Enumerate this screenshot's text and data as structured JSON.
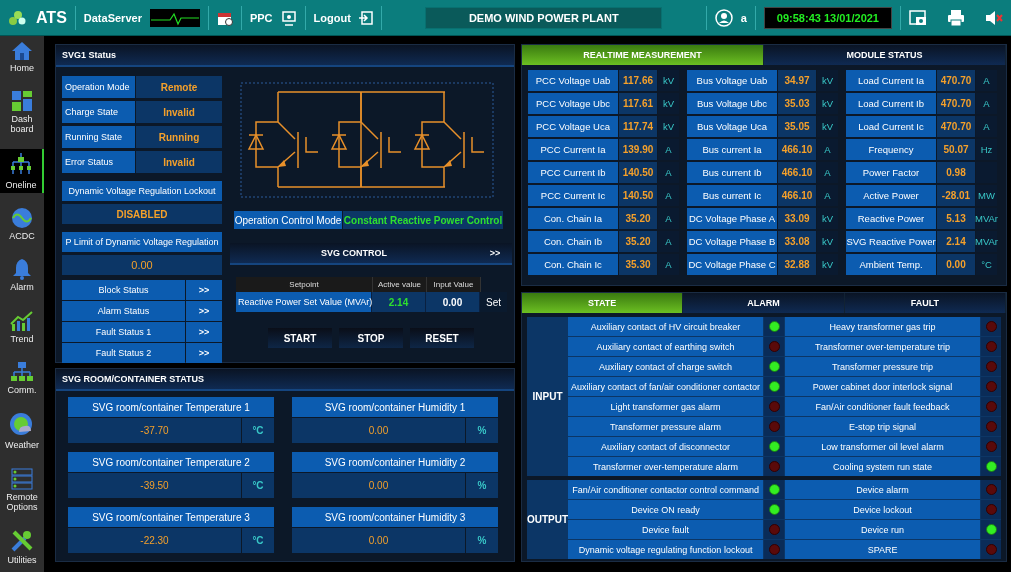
{
  "topbar": {
    "logo": "ATS",
    "server": "DataServer",
    "ppc": "PPC",
    "logout": "Logout",
    "plant": "DEMO WIND POWER PLANT",
    "user": "a",
    "clock": "09:58:43 13/01/2021"
  },
  "sidebar": {
    "items": [
      {
        "label": "Home",
        "selected": false
      },
      {
        "label": "Dash board",
        "selected": false
      },
      {
        "label": "Oneline",
        "selected": true
      },
      {
        "label": "ACDC",
        "selected": false
      },
      {
        "label": "Alarm",
        "selected": false
      },
      {
        "label": "Trend",
        "selected": false
      },
      {
        "label": "Comm.",
        "selected": false
      },
      {
        "label": "Weather",
        "selected": false
      },
      {
        "label": "Remote Options",
        "selected": false
      },
      {
        "label": "Utilities",
        "selected": false
      }
    ]
  },
  "svg1": {
    "title": "SVG1 Status",
    "status_rows": [
      {
        "label": "Operation Mode",
        "value": "Remote"
      },
      {
        "label": "Charge State",
        "value": "Invalid"
      },
      {
        "label": "Running State",
        "value": "Running"
      },
      {
        "label": "Error Status",
        "value": "Invalid"
      }
    ],
    "lockout": {
      "label": "Dynamic Voltage Regulation Lockout",
      "value": "DISABLED"
    },
    "p_limit": {
      "label": "P Limit of Dynamic Voltage Regulation",
      "value": "0.00"
    },
    "links": [
      {
        "label": "Block Status",
        "arrow": ">>"
      },
      {
        "label": "Alarm Status",
        "arrow": ">>"
      },
      {
        "label": "Fault Status 1",
        "arrow": ">>"
      },
      {
        "label": "Fault Status 2",
        "arrow": ">>"
      }
    ],
    "control_mode": {
      "label": "Operation Control Mode",
      "value": "Constant Reactive Power Control"
    },
    "svg_control": {
      "title": "SVG CONTROL",
      "arrow": ">>",
      "columns": [
        "Setpoint",
        "Active value",
        "Input Value"
      ],
      "row": {
        "label": "Reactive Power Set Value (MVAr)",
        "active": "2.14",
        "input": "0.00",
        "set": "Set"
      },
      "buttons": [
        "START",
        "STOP",
        "RESET"
      ]
    }
  },
  "room": {
    "title": "SVG ROOM/CONTAINER STATUS",
    "sensors": [
      {
        "label": "SVG room/container Temperature 1",
        "value": "-37.70",
        "unit": "°C"
      },
      {
        "label": "SVG room/container Humidity 1",
        "value": "0.00",
        "unit": "%"
      },
      {
        "label": "SVG room/container Temperature 2",
        "value": "-39.50",
        "unit": "°C"
      },
      {
        "label": "SVG room/container Humidity 2",
        "value": "0.00",
        "unit": "%"
      },
      {
        "label": "SVG room/container Temperature 3",
        "value": "-22.30",
        "unit": "°C"
      },
      {
        "label": "SVG room/container Humidity 3",
        "value": "0.00",
        "unit": "%"
      }
    ]
  },
  "measure": {
    "tabs": [
      {
        "label": "REALTIME MEASUREMENT",
        "selected": true
      },
      {
        "label": "MODULE STATUS",
        "selected": false
      }
    ],
    "columns": [
      [
        {
          "label": "PCC Voltage Uab",
          "value": "117.66",
          "unit": "kV"
        },
        {
          "label": "PCC Voltage Ubc",
          "value": "117.61",
          "unit": "kV"
        },
        {
          "label": "PCC Voltage Uca",
          "value": "117.74",
          "unit": "kV"
        },
        {
          "label": "PCC Current Ia",
          "value": "139.90",
          "unit": "A"
        },
        {
          "label": "PCC Current Ib",
          "value": "140.50",
          "unit": "A"
        },
        {
          "label": "PCC Current Ic",
          "value": "140.50",
          "unit": "A"
        },
        {
          "label": "Con. Chain Ia",
          "value": "35.20",
          "unit": "A"
        },
        {
          "label": "Con. Chain Ib",
          "value": "35.20",
          "unit": "A"
        },
        {
          "label": "Con. Chain Ic",
          "value": "35.30",
          "unit": "A"
        }
      ],
      [
        {
          "label": "Bus Voltage Uab",
          "value": "34.97",
          "unit": "kV"
        },
        {
          "label": "Bus Voltage Ubc",
          "value": "35.03",
          "unit": "kV"
        },
        {
          "label": "Bus Voltage Uca",
          "value": "35.05",
          "unit": "kV"
        },
        {
          "label": "Bus current Ia",
          "value": "466.10",
          "unit": "A"
        },
        {
          "label": "Bus current Ib",
          "value": "466.10",
          "unit": "A"
        },
        {
          "label": "Bus current Ic",
          "value": "466.10",
          "unit": "A"
        },
        {
          "label": "DC Voltage Phase A",
          "value": "33.09",
          "unit": "kV"
        },
        {
          "label": "DC Voltage Phase B",
          "value": "33.08",
          "unit": "kV"
        },
        {
          "label": "DC Voltage Phase C",
          "value": "32.88",
          "unit": "kV"
        }
      ],
      [
        {
          "label": "Load Current Ia",
          "value": "470.70",
          "unit": "A"
        },
        {
          "label": "Load Current Ib",
          "value": "470.70",
          "unit": "A"
        },
        {
          "label": "Load Current Ic",
          "value": "470.70",
          "unit": "A"
        },
        {
          "label": "Frequency",
          "value": "50.07",
          "unit": "Hz"
        },
        {
          "label": "Power Factor",
          "value": "0.98"
        },
        {
          "label": "Active Power",
          "value": "-28.01",
          "unit": "MW"
        },
        {
          "label": "Reactive Power",
          "value": "5.13",
          "unit": "MVAr"
        },
        {
          "label": "SVG Reactive Power",
          "value": "2.14",
          "unit": "MVAr"
        },
        {
          "label": "Ambient Temp.",
          "value": "0.00",
          "unit": "°C"
        }
      ]
    ]
  },
  "io": {
    "tabs": [
      {
        "label": "STATE",
        "selected": true
      },
      {
        "label": "ALARM",
        "selected": false
      },
      {
        "label": "FAULT",
        "selected": false
      }
    ],
    "groups": [
      {
        "label": "INPUT",
        "rows": [
          {
            "left": {
              "label": "Auxiliary contact of HV circuit breaker",
              "on": true
            },
            "right": {
              "label": "Heavy transformer gas trip",
              "on": false
            }
          },
          {
            "left": {
              "label": "Auxiliary contact of earthing switch",
              "on": false
            },
            "right": {
              "label": "Transformer over-temperature trip",
              "on": false
            }
          },
          {
            "left": {
              "label": "Auxiliary contact of charge switch",
              "on": true
            },
            "right": {
              "label": "Transformer pressure trip",
              "on": false
            }
          },
          {
            "left": {
              "label": "Auxiliary contact of fan/air conditioner contactor",
              "on": true
            },
            "right": {
              "label": "Power cabinet door interlock signal",
              "on": false
            }
          },
          {
            "left": {
              "label": "Light transformer gas alarm",
              "on": false
            },
            "right": {
              "label": "Fan/Air conditioner fault feedback",
              "on": false
            }
          },
          {
            "left": {
              "label": "Transformer pressure alarm",
              "on": false
            },
            "right": {
              "label": "E-stop trip signal",
              "on": false
            }
          },
          {
            "left": {
              "label": "Auxiliary contact of disconnector",
              "on": true
            },
            "right": {
              "label": "Low transformer oil level alarm",
              "on": false
            }
          },
          {
            "left": {
              "label": "Transformer over-temperature alarm",
              "on": false
            },
            "right": {
              "label": "Cooling system run state",
              "on": true
            }
          }
        ]
      },
      {
        "label": "OUTPUT",
        "rows": [
          {
            "left": {
              "label": "Fan/Air conditioner contactor control command",
              "on": true
            },
            "right": {
              "label": "Device alarm",
              "on": false
            }
          },
          {
            "left": {
              "label": "Device ON ready",
              "on": true
            },
            "right": {
              "label": "Device lockout",
              "on": false
            }
          },
          {
            "left": {
              "label": "Device fault",
              "on": false
            },
            "right": {
              "label": "Device run",
              "on": true
            }
          },
          {
            "left": {
              "label": "Dynamic voltage regulating function lockout",
              "on": false
            },
            "right": {
              "label": "SPARE",
              "on": false
            }
          }
        ]
      }
    ]
  }
}
